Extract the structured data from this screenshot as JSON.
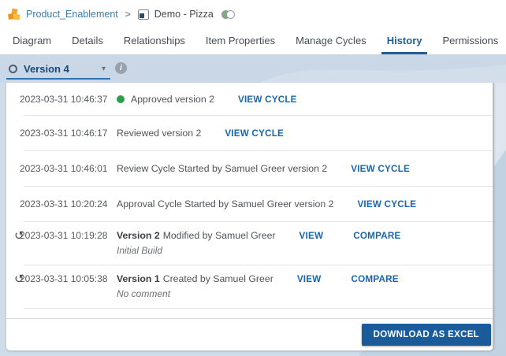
{
  "header": {
    "breadcrumb": {
      "root": "Product_Enablement",
      "separator": ">",
      "current": "Demo - Pizza"
    }
  },
  "tabs": [
    {
      "label": "Diagram",
      "active": false
    },
    {
      "label": "Details",
      "active": false
    },
    {
      "label": "Relationships",
      "active": false
    },
    {
      "label": "Item Properties",
      "active": false
    },
    {
      "label": "Manage Cycles",
      "active": false
    },
    {
      "label": "History",
      "active": true
    },
    {
      "label": "Permissions",
      "active": false
    }
  ],
  "version_selector": {
    "value": "Version 4"
  },
  "icons": {
    "breadcrumb_cubes": "cubes-icon",
    "item": "diagram-item-icon",
    "toggle": "toggle-icon",
    "info": "i",
    "caret": "▾",
    "restore": "↺",
    "approved_dot": "green-status-dot"
  },
  "history_rows": [
    {
      "restorable": false,
      "timestamp": "2023-03-31 10:46:37",
      "status_dot": true,
      "text": "Approved version 2",
      "links": [
        "VIEW CYCLE"
      ]
    },
    {
      "restorable": false,
      "timestamp": "2023-03-31 10:46:17",
      "status_dot": false,
      "text": "Reviewed version 2",
      "links": [
        "VIEW CYCLE"
      ]
    },
    {
      "restorable": false,
      "timestamp": "2023-03-31 10:46:01",
      "status_dot": false,
      "text": "Review Cycle Started by Samuel Greer version 2",
      "links": [
        "VIEW CYCLE"
      ]
    },
    {
      "restorable": false,
      "timestamp": "2023-03-31 10:20:24",
      "status_dot": false,
      "text": "Approval Cycle Started by Samuel Greer version 2",
      "links": [
        "VIEW CYCLE"
      ]
    },
    {
      "restorable": true,
      "timestamp": "2023-03-31 10:19:28",
      "status_dot": false,
      "version": "Version 2",
      "text": "Modified by Samuel Greer",
      "comment": "Initial Build",
      "links": [
        "VIEW",
        "COMPARE"
      ]
    },
    {
      "restorable": true,
      "timestamp": "2023-03-31 10:05:38",
      "status_dot": false,
      "version": "Version 1",
      "text": "Created by Samuel Greer",
      "comment": "No comment",
      "links": [
        "VIEW",
        "COMPARE"
      ]
    }
  ],
  "footer": {
    "download_button": "DOWNLOAD AS EXCEL"
  },
  "colors": {
    "link_blue": "#1766b4",
    "active_tab_blue": "#1d5f9e",
    "button_blue": "#1a5b9b",
    "approved_green": "#2f9e4e",
    "banner_blue": "#c9d7e6",
    "page_background_blue": "#cfdce9",
    "breadcrumb_blue": "#3d7ba6",
    "version_label_blue": "#1b4a74"
  }
}
